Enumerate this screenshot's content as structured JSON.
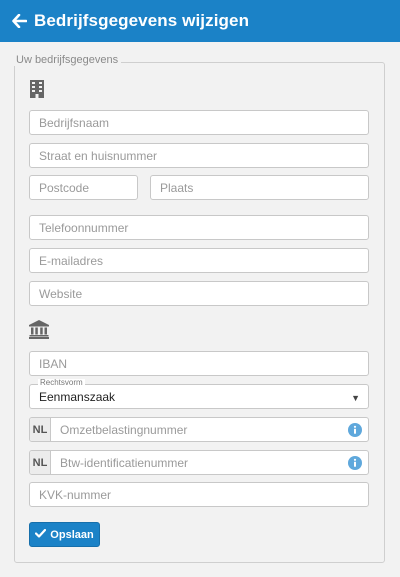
{
  "header": {
    "title": "Bedrijfsgegevens wijzigen",
    "background": "#1b82c7"
  },
  "panel": {
    "legend": "Uw bedrijfsgegevens"
  },
  "fields": {
    "company_name": {
      "placeholder": "Bedrijfsnaam",
      "value": ""
    },
    "street": {
      "placeholder": "Straat en huisnummer",
      "value": ""
    },
    "postcode": {
      "placeholder": "Postcode",
      "value": ""
    },
    "city": {
      "placeholder": "Plaats",
      "value": ""
    },
    "phone": {
      "placeholder": "Telefoonnummer",
      "value": ""
    },
    "email": {
      "placeholder": "E-mailadres",
      "value": ""
    },
    "website": {
      "placeholder": "Website",
      "value": ""
    },
    "iban": {
      "placeholder": "IBAN",
      "value": ""
    },
    "vat": {
      "prefix": "NL",
      "placeholder": "Omzetbelastingnummer",
      "value": ""
    },
    "btw_id": {
      "prefix": "NL",
      "placeholder": "Btw-identificatienummer",
      "value": ""
    },
    "kvk": {
      "placeholder": "KVK-nummer",
      "value": ""
    }
  },
  "legal_form": {
    "label": "Rechtsvorm",
    "selected": "Eenmanszaak"
  },
  "icons": {
    "company": "building-icon",
    "bank": "bank-icon",
    "info": "info-icon",
    "back": "arrow-left-icon",
    "check": "check-icon"
  },
  "save_button": {
    "label": "Opslaan"
  },
  "colors": {
    "accent": "#1b82c7",
    "info": "#5fa8dc"
  }
}
